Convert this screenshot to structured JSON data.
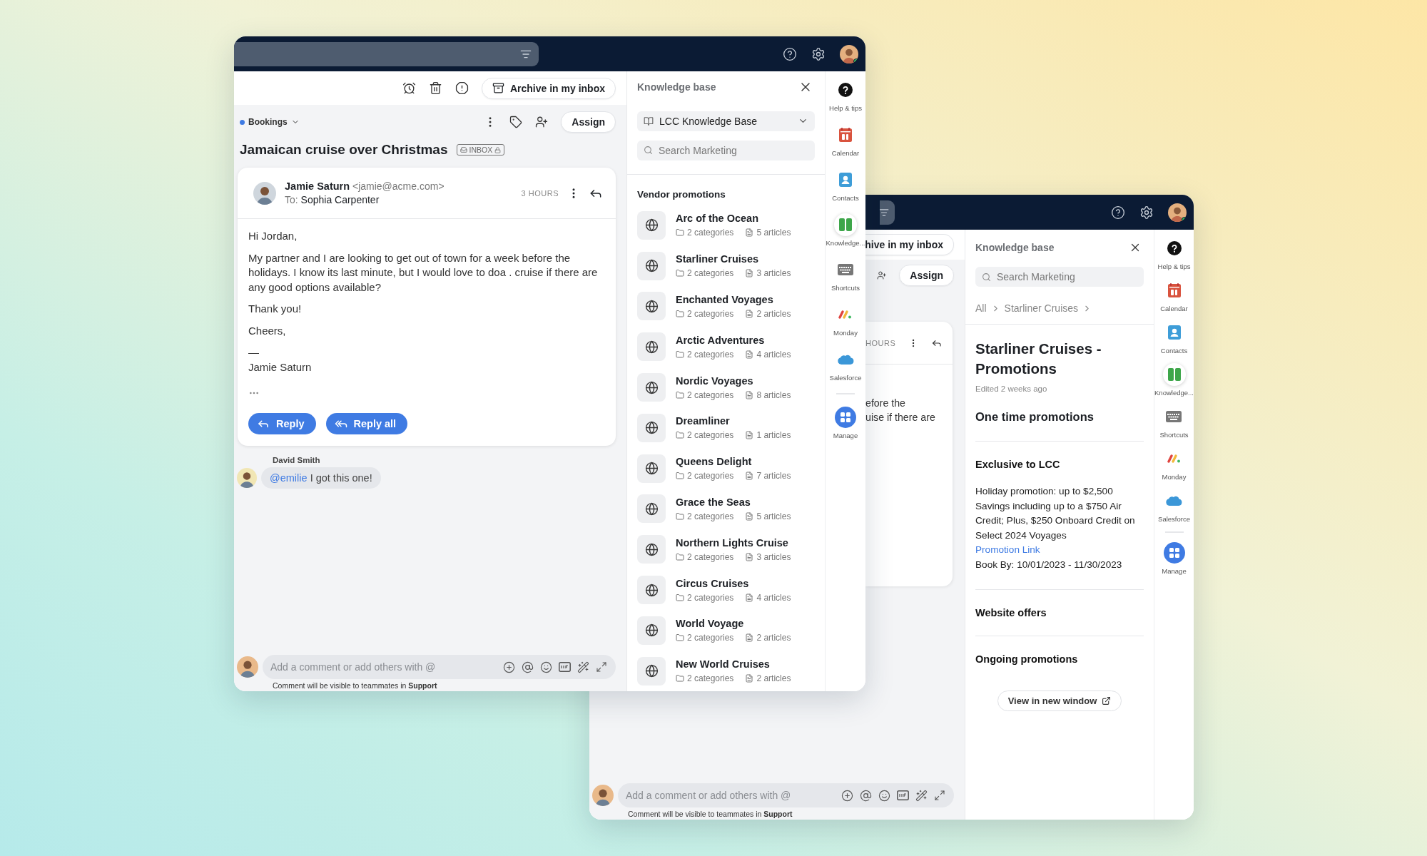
{
  "front_window": {
    "toolbar": {
      "archive_button": "Archive in my inbox"
    },
    "conversation": {
      "inbox_dropdown": "Bookings",
      "assign_button": "Assign",
      "title": "Jamaican cruise over Christmas",
      "tag": "INBOX",
      "message": {
        "sender": "Jamie Saturn",
        "email": "<jamie@acme.com>",
        "to_label": "To:",
        "recipient": "Sophia Carpenter",
        "time": "3 HOURS",
        "body": [
          "Hi Jordan,",
          "My partner and I are looking to get out of town for a week before the holidays. I know its last minute, but I would love to doa . cruise if there are any good options available?",
          "Thank you!",
          "Cheers,"
        ],
        "signature": [
          "—",
          "Jamie Saturn"
        ],
        "buttons": [
          {
            "kind": "reply",
            "label": "Reply"
          },
          {
            "kind": "reply_all",
            "label": "Reply all"
          }
        ]
      },
      "comment": {
        "author": "David Smith",
        "mention": "@emilie",
        "text": "I got this one!"
      }
    },
    "composer": {
      "placeholder": "Add a comment or add others with @",
      "hint": "Comment will be visible to teammates in **Support**"
    },
    "knowledge_panel": {
      "title": "Knowledge base",
      "selector": "LCC Knowledge Base",
      "search_placeholder": "Search Marketing",
      "section": "Vendor promotions",
      "items": [
        {
          "name": "Arc of the Ocean",
          "categories": "2 categories",
          "articles": "5 articles"
        },
        {
          "name": "Starliner Cruises",
          "categories": "2 categories",
          "articles": "3 articles"
        },
        {
          "name": "Enchanted Voyages",
          "categories": "2 categories",
          "articles": "2 articles"
        },
        {
          "name": "Arctic Adventures",
          "categories": "2 categories",
          "articles": "4 articles"
        },
        {
          "name": "Nordic Voyages",
          "categories": "2 categories",
          "articles": "8 articles"
        },
        {
          "name": "Dreamliner",
          "categories": "2 categories",
          "articles": "1 articles"
        },
        {
          "name": "Queens Delight",
          "categories": "2 categories",
          "articles": "7 articles"
        },
        {
          "name": "Grace the Seas",
          "categories": "2 categories",
          "articles": "5 articles"
        },
        {
          "name": "Northern Lights Cruise",
          "categories": "2 categories",
          "articles": "3 articles"
        },
        {
          "name": "Circus Cruises",
          "categories": "2 categories",
          "articles": "4 articles"
        },
        {
          "name": "World Voyage",
          "categories": "2 categories",
          "articles": "2 articles"
        },
        {
          "name": "New World Cruises",
          "categories": "2 categories",
          "articles": "2 articles"
        }
      ]
    },
    "rail": [
      {
        "kind": "help",
        "label": "Help & tips",
        "selected": false
      },
      {
        "kind": "calendar",
        "label": "Calendar",
        "selected": false
      },
      {
        "kind": "contacts",
        "label": "Contacts",
        "selected": false
      },
      {
        "kind": "knowledge",
        "label": "Knowledge...",
        "selected": true
      },
      {
        "kind": "shortcuts",
        "label": "Shortcuts",
        "selected": false
      },
      {
        "kind": "monday",
        "label": "Monday",
        "selected": false
      },
      {
        "kind": "salesforce",
        "label": "Salesforce",
        "selected": false
      },
      {
        "kind": "manage",
        "label": "Manage",
        "selected": false
      }
    ]
  },
  "back_window": {
    "conversation": {
      "archive_button": "hive in my inbox",
      "assign_button": "Assign",
      "time": "HOURS",
      "body_lines": [
        "efore the",
        "uise if there are"
      ]
    },
    "composer": {
      "placeholder": "Add a comment or add others with @",
      "hint": "Comment will be visible to teammates in **Support**"
    },
    "knowledge_panel": {
      "title": "Knowledge base",
      "search_placeholder": "Search Marketing",
      "breadcrumb": [
        "All",
        "Starliner Cruises"
      ],
      "article": {
        "title": "Starliner Cruises - Promotions",
        "edited": "Edited 2 weeks ago",
        "sections": [
          {
            "kind": "lead",
            "heading": "One time promotions"
          },
          {
            "kind": "section",
            "heading": "Exclusive to LCC",
            "body": "Holiday promotion: up to $2,500 Savings including up to a $750 Air Credit; Plus, $250 Onboard Credit on Select 2024 Voyages",
            "link": "Promotion Link",
            "note": "Book By: 10/01/2023 - 11/30/2023"
          },
          {
            "kind": "section",
            "heading": "Website offers"
          },
          {
            "kind": "section",
            "heading": "Ongoing promotions"
          }
        ],
        "button": "View in new window"
      }
    },
    "rail": [
      {
        "kind": "help",
        "label": "Help & tips",
        "selected": false
      },
      {
        "kind": "calendar",
        "label": "Calendar",
        "selected": false
      },
      {
        "kind": "contacts",
        "label": "Contacts",
        "selected": false
      },
      {
        "kind": "knowledge",
        "label": "Knowledge...",
        "selected": true
      },
      {
        "kind": "shortcuts",
        "label": "Shortcuts",
        "selected": false
      },
      {
        "kind": "monday",
        "label": "Monday",
        "selected": false
      },
      {
        "kind": "salesforce",
        "label": "Salesforce",
        "selected": false
      },
      {
        "kind": "manage",
        "label": "Manage",
        "selected": false
      }
    ]
  }
}
